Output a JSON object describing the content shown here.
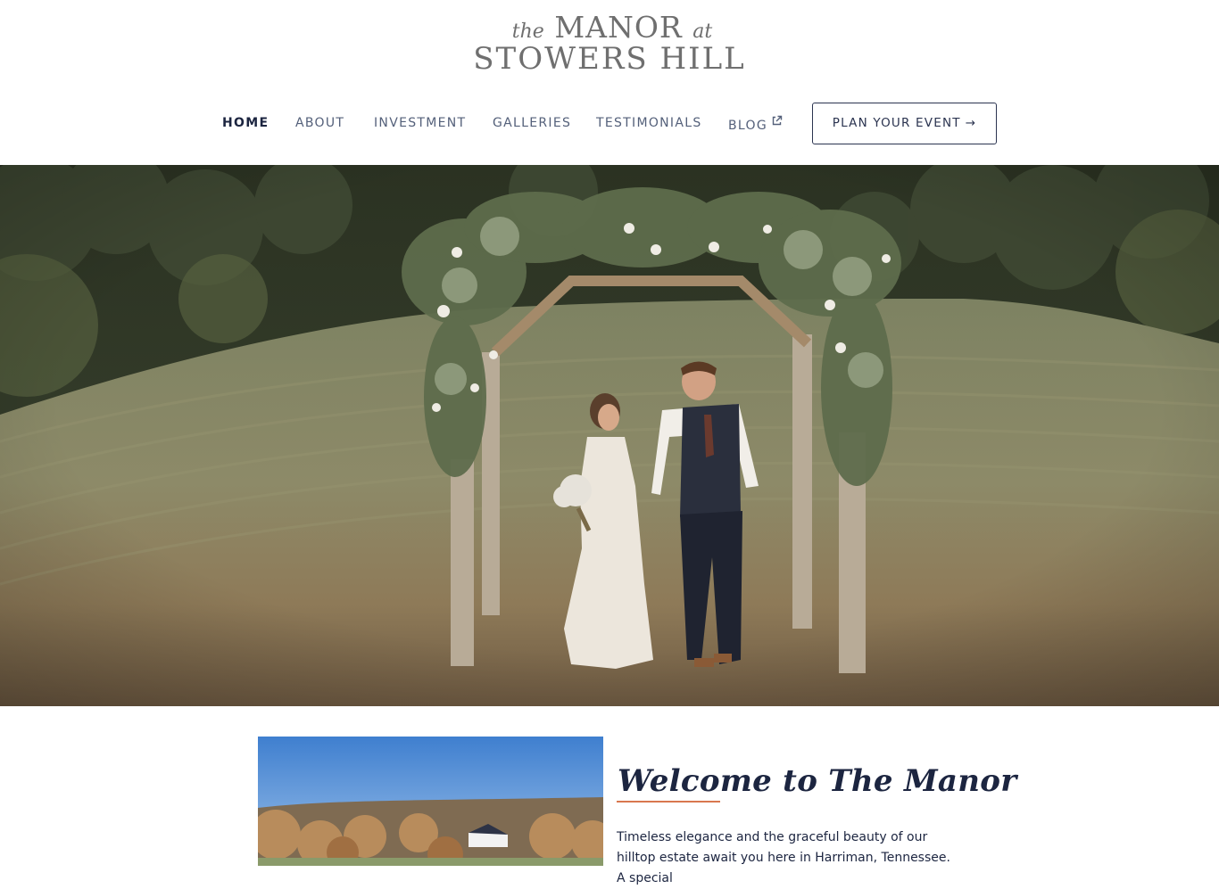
{
  "logo": {
    "the": "the",
    "manor": "MANOR",
    "at": "at",
    "stowers_hill": "STOWERS HILL"
  },
  "nav": {
    "items": [
      {
        "label": "HOME",
        "active": true
      },
      {
        "label": "ABOUT",
        "active": false
      },
      {
        "label": "INVESTMENT",
        "active": false
      },
      {
        "label": "GALLERIES",
        "active": false
      },
      {
        "label": "TESTIMONIALS",
        "active": false
      },
      {
        "label": "BLOG",
        "active": false,
        "icon": "external-link-icon"
      }
    ],
    "cta_label": "PLAN YOUR EVENT",
    "cta_icon": "arrow-right-icon"
  },
  "welcome": {
    "title": "Welcome to The Manor",
    "text": "Timeless elegance and the graceful beauty of our hilltop estate await you here in Harriman, Tennessee. A special"
  },
  "colors": {
    "navy": "#1c2540",
    "accent_rule": "#d9774f",
    "nav_text": "#54607a",
    "logo_grey": "#6f6f6f"
  }
}
